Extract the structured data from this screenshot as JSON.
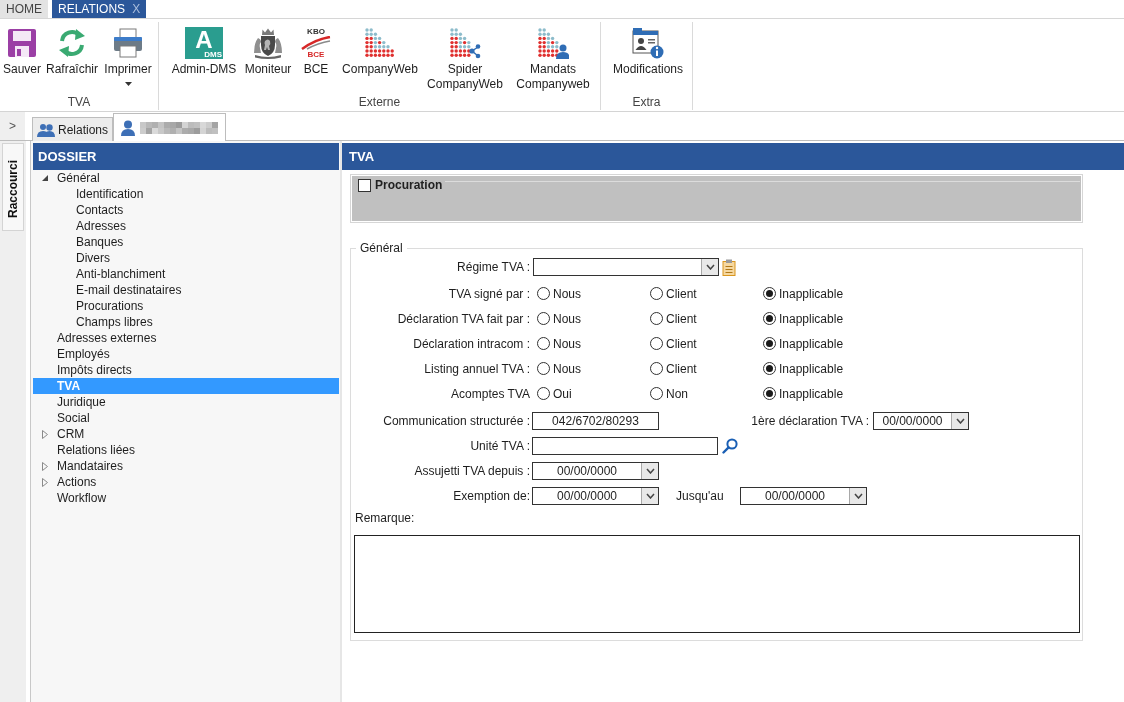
{
  "menu_tabs": [
    {
      "label": "HOME",
      "selected": false
    },
    {
      "label": "RELATIONS",
      "selected": true,
      "close": "X"
    }
  ],
  "ribbon": [
    {
      "label": "TVA",
      "buttons": [
        {
          "label": "Sauver",
          "kind": "save",
          "dropdown": false
        },
        {
          "label": "Rafraîchir",
          "kind": "refresh",
          "dropdown": false
        },
        {
          "label": "Imprimer",
          "kind": "print",
          "dropdown": true
        }
      ]
    },
    {
      "label": "Externe",
      "buttons": [
        {
          "label": "Admin-DMS",
          "kind": "dms",
          "dropdown": false,
          "logo_text": [
            "A",
            "DMS"
          ]
        },
        {
          "label": "Moniteur",
          "kind": "crest",
          "dropdown": false
        },
        {
          "label": "BCE",
          "kind": "kbo",
          "dropdown": false,
          "logo_text": [
            "KBO",
            "BCE"
          ]
        },
        {
          "label": "CompanyWeb",
          "kind": "dots",
          "dropdown": false
        },
        {
          "label": "Spider CompanyWeb",
          "kind": "dots_share",
          "dropdown": false
        },
        {
          "label": "Mandats Companyweb",
          "kind": "dots_person",
          "dropdown": false
        }
      ]
    },
    {
      "label": "Extra",
      "buttons": [
        {
          "label": "Modifications",
          "kind": "card",
          "dropdown": false
        }
      ]
    }
  ],
  "shortcut_bar": {
    "toggle": ">",
    "tab": "Raccourci"
  },
  "document_tabs": [
    {
      "label": "Relations",
      "kind": "group",
      "selected": false,
      "name_hidden": false
    },
    {
      "kind": "person",
      "selected": true,
      "name_hidden": true
    }
  ],
  "sidebar": {
    "title": "DOSSIER",
    "items": [
      {
        "label": "Général",
        "expandable": true,
        "expanded": true,
        "selected": false,
        "children": [
          {
            "label": "Identification",
            "selected": false
          },
          {
            "label": "Contacts",
            "selected": false
          },
          {
            "label": "Adresses",
            "selected": false
          },
          {
            "label": "Banques",
            "selected": false
          },
          {
            "label": "Divers",
            "selected": false
          },
          {
            "label": "Anti-blanchiment",
            "selected": false
          },
          {
            "label": "E-mail destinataires",
            "selected": false
          },
          {
            "label": "Procurations",
            "selected": false
          },
          {
            "label": "Champs libres",
            "selected": false
          }
        ]
      },
      {
        "label": "Adresses externes",
        "expandable": false,
        "expanded": false,
        "selected": false
      },
      {
        "label": "Employés",
        "expandable": false,
        "expanded": false,
        "selected": false
      },
      {
        "label": "Impôts directs",
        "expandable": false,
        "expanded": false,
        "selected": false
      },
      {
        "label": "TVA",
        "expandable": false,
        "expanded": false,
        "selected": true
      },
      {
        "label": "Juridique",
        "expandable": false,
        "expanded": false,
        "selected": false
      },
      {
        "label": "Social",
        "expandable": false,
        "expanded": false,
        "selected": false
      },
      {
        "label": "CRM",
        "expandable": true,
        "expanded": false,
        "selected": false
      },
      {
        "label": "Relations liées",
        "expandable": false,
        "expanded": false,
        "selected": false
      },
      {
        "label": "Mandataires",
        "expandable": true,
        "expanded": false,
        "selected": false
      },
      {
        "label": "Actions",
        "expandable": true,
        "expanded": false,
        "selected": false
      },
      {
        "label": "Workflow",
        "expandable": false,
        "expanded": false,
        "selected": false
      }
    ]
  },
  "panel": {
    "title": "TVA",
    "procuration": {
      "label": "Procuration",
      "checked": false
    },
    "general": {
      "legend": "Général",
      "regime": {
        "label": "Régime TVA :"
      },
      "choices": [
        {
          "label": "TVA signé par :",
          "options": [
            {
              "label": "Nous",
              "selected": false
            },
            {
              "label": "Client",
              "selected": false
            },
            {
              "label": "Inapplicable",
              "selected": true
            }
          ]
        },
        {
          "label": "Déclaration TVA fait par :",
          "options": [
            {
              "label": "Nous",
              "selected": false
            },
            {
              "label": "Client",
              "selected": false
            },
            {
              "label": "Inapplicable",
              "selected": true
            }
          ]
        },
        {
          "label": "Déclaration intracom :",
          "options": [
            {
              "label": "Nous",
              "selected": false
            },
            {
              "label": "Client",
              "selected": false
            },
            {
              "label": "Inapplicable",
              "selected": true
            }
          ]
        },
        {
          "label": "Listing annuel TVA :",
          "options": [
            {
              "label": "Nous",
              "selected": false
            },
            {
              "label": "Client",
              "selected": false
            },
            {
              "label": "Inapplicable",
              "selected": true
            }
          ]
        },
        {
          "label": "Acomptes TVA",
          "options": [
            {
              "label": "Oui",
              "selected": false
            },
            {
              "label": "Non",
              "selected": false
            },
            {
              "label": "Inapplicable",
              "selected": true
            }
          ]
        }
      ],
      "communication": {
        "label": "Communication structurée :",
        "value": "042/6702/80293"
      },
      "first_declaration": {
        "label": "1ère déclaration TVA :",
        "value": "00/00/0000"
      },
      "vat_unit": {
        "label": "Unité TVA :"
      },
      "liable_since": {
        "label": "Assujetti TVA depuis :",
        "value": "00/00/0000"
      },
      "exemption_from": {
        "label": "Exemption de:",
        "value": "00/00/0000"
      },
      "exemption_until": {
        "label": "Jusqu'au",
        "value": "00/00/0000"
      },
      "remark": {
        "label": "Remarque:"
      }
    }
  }
}
